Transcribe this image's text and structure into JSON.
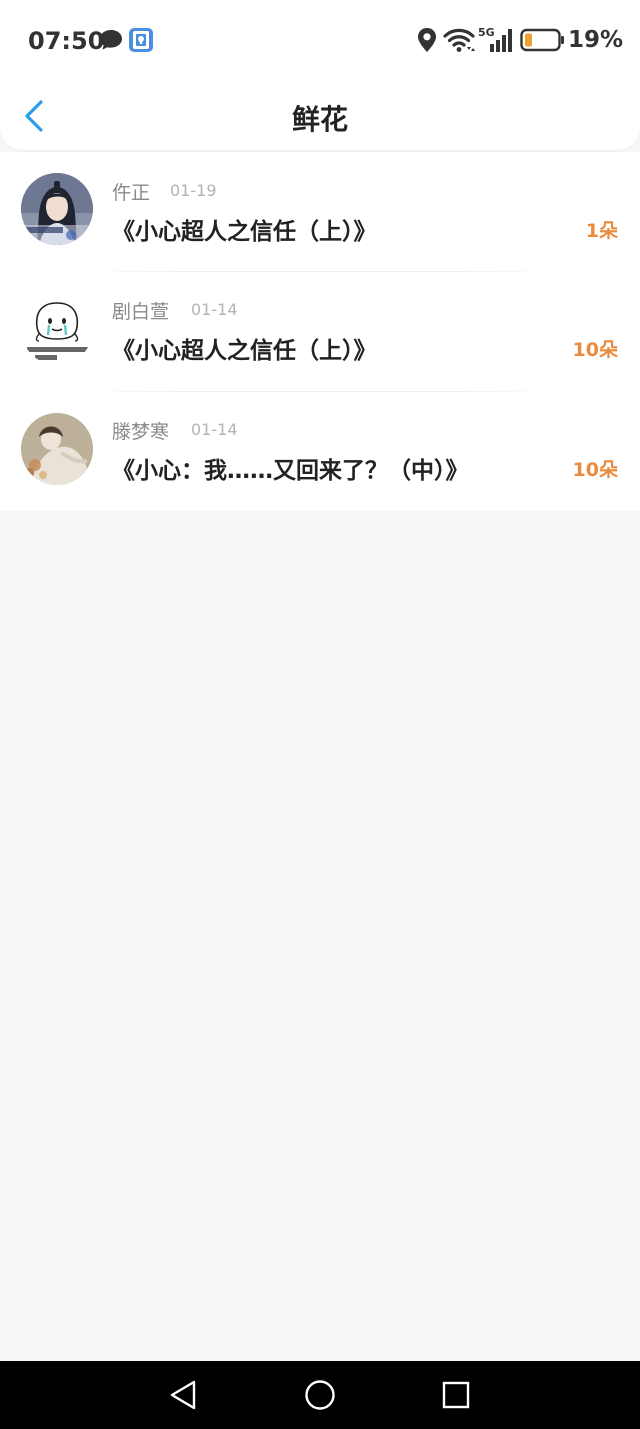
{
  "status_bar": {
    "time": "07:50",
    "battery": "19%",
    "network": "5G",
    "icons": [
      "message-icon",
      "app-shield-icon",
      "location-icon",
      "wifi-icon",
      "cellular-signal-icon",
      "battery-icon"
    ],
    "battery_color": "#f0a030"
  },
  "header": {
    "title": "鲜花",
    "back_icon": "chevron-left-icon",
    "accent": "#2a9de8"
  },
  "list": {
    "count_color": "#ec8a3c",
    "items": [
      {
        "user": "仵正",
        "date": "01-19",
        "title": "《小心超人之信任（上）》",
        "count": "1朵"
      },
      {
        "user": "剧白萱",
        "date": "01-14",
        "title": "《小心超人之信任（上）》",
        "count": "10朵"
      },
      {
        "user": "滕梦寒",
        "date": "01-14",
        "title": "《小心：我……又回来了？（中）》",
        "count": "10朵"
      }
    ]
  },
  "nav_bar": {
    "icons": [
      "triangle-back-icon",
      "circle-home-icon",
      "square-recents-icon"
    ]
  }
}
